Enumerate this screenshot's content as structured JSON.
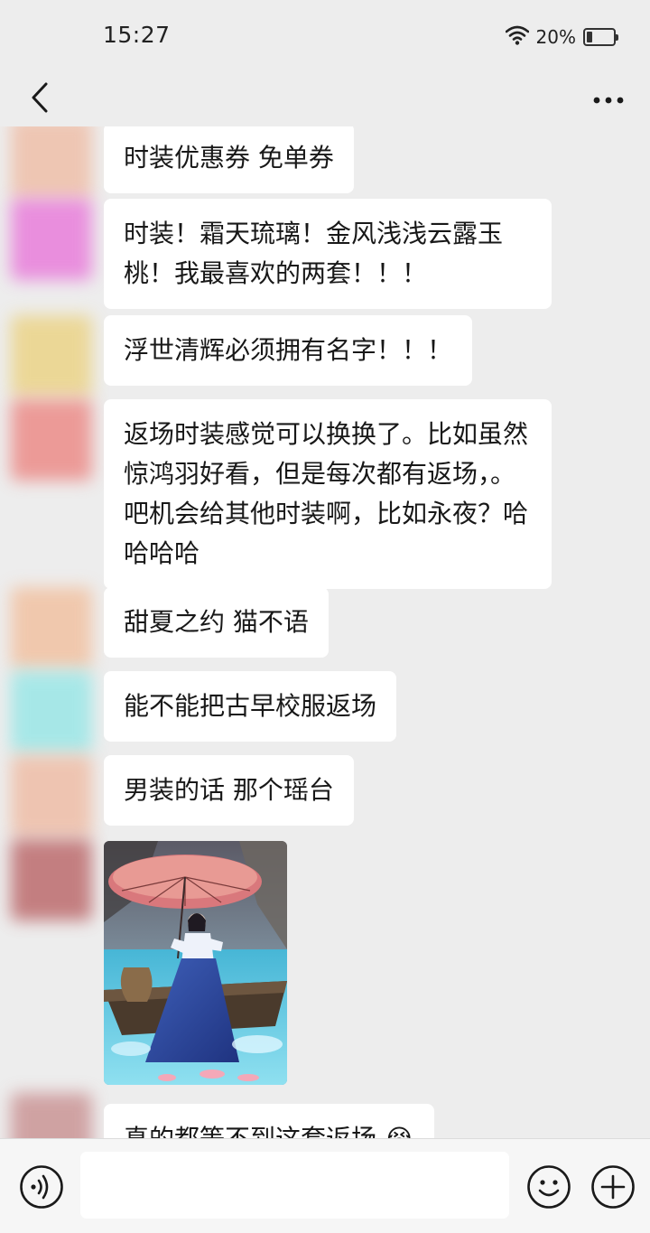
{
  "status_bar": {
    "time": "15:27",
    "battery_percent": "20%",
    "battery_level": 0.2,
    "icons": [
      "wifi-icon",
      "battery-icon"
    ]
  },
  "header": {
    "back_icon": "chevron-left-icon",
    "more_icon": "more-horizontal-icon"
  },
  "messages": [
    {
      "type": "text",
      "text": "时装优惠券 免单券",
      "avatar_color": "#efb9a0"
    },
    {
      "type": "text",
      "text": "时装！霜天琉璃！金风浅浅云露玉桃！我最喜欢的两套！！！",
      "avatar_color": "#e86fd8"
    },
    {
      "type": "text",
      "text": "浮世清辉必须拥有名字！！！",
      "avatar_color": "#ebd07a"
    },
    {
      "type": "text",
      "text": "返场时装感觉可以换换了。比如虽然惊鸿羽好看，但是每次都有返场，。吧机会给其他时装啊，比如永夜？哈哈哈哈",
      "avatar_color": "#ec7f7b"
    },
    {
      "type": "text",
      "text": "甜夏之约 猫不语",
      "avatar_color": "#f2bc98"
    },
    {
      "type": "text",
      "text": "能不能把古早校服返场",
      "avatar_color": "#8fe6e6"
    },
    {
      "type": "text",
      "text": "男装的话 那个瑶台",
      "avatar_color": "#efb79d"
    },
    {
      "type": "image",
      "description_icon": "game-character-image",
      "avatar_color": "#b65a5c"
    },
    {
      "type": "text",
      "text": "真的都等不到这套返场 😭",
      "avatar_color": "#c6898a"
    }
  ],
  "input_bar": {
    "voice_icon": "voice-icon",
    "emoji_icon": "emoji-icon",
    "plus_icon": "plus-circle-icon",
    "input_value": ""
  },
  "colors": {
    "background": "#ededed",
    "bubble": "#ffffff",
    "input_bar": "#f6f6f6"
  }
}
